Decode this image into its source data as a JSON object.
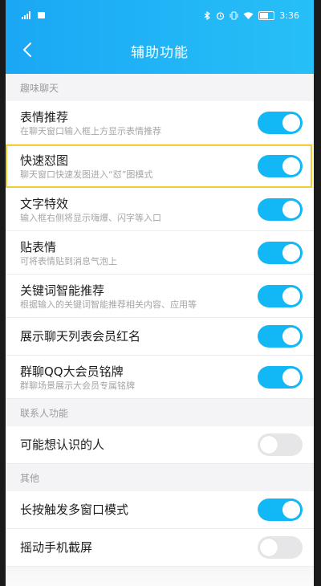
{
  "status_bar": {
    "left_icons": [
      "signal-icon",
      "sim-icon"
    ],
    "right_icons": [
      "bluetooth-icon",
      "alarm-icon",
      "vibrate-icon",
      "wifi-icon",
      "battery-icon"
    ],
    "time": "3:36"
  },
  "nav": {
    "title": "辅助功能",
    "back_icon": "chevron-left-icon"
  },
  "sections": [
    {
      "header": "趣味聊天",
      "items": [
        {
          "label": "表情推荐",
          "desc": "在聊天窗口输入框上方显示表情推荐",
          "on": true
        },
        {
          "label": "快速怼图",
          "desc": "聊天窗口快速发图进入“怼”图模式",
          "on": true
        },
        {
          "label": "文字特效",
          "desc": "输入框右侧将显示嗨爆、闪字等入口",
          "on": true
        },
        {
          "label": "贴表情",
          "desc": "可将表情贴到消息气泡上",
          "on": true
        },
        {
          "label": "关键词智能推荐",
          "desc": "根据输入的关键词智能推荐相关内容、应用等",
          "on": true
        },
        {
          "label": "展示聊天列表会员红名",
          "desc": "",
          "on": true
        },
        {
          "label": "群聊QQ大会员铭牌",
          "desc": "群聊场景展示大会员专属铭牌",
          "on": true
        }
      ]
    },
    {
      "header": "联系人功能",
      "items": [
        {
          "label": "可能想认识的人",
          "desc": "",
          "on": false
        }
      ]
    },
    {
      "header": "其他",
      "items": [
        {
          "label": "长按触发多窗口模式",
          "desc": "",
          "on": true
        },
        {
          "label": "摇动手机截屏",
          "desc": "",
          "on": false
        }
      ]
    }
  ],
  "colors": {
    "accent": "#12b7f5",
    "header_start": "#1aa7f4",
    "header_end": "#27bff7",
    "highlight": "#f3cd35"
  }
}
